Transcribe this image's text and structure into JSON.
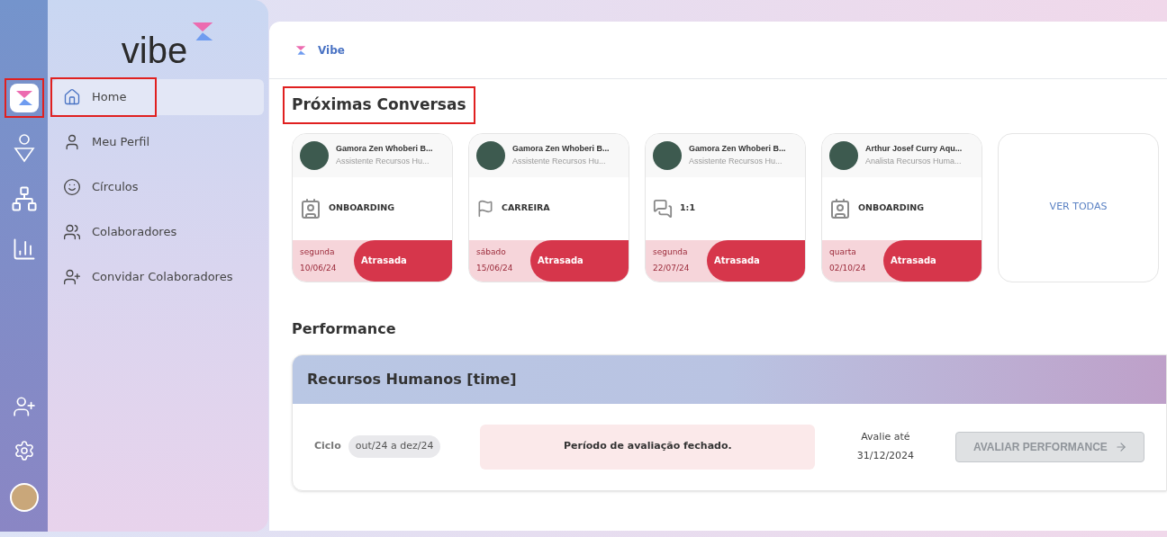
{
  "rail": {
    "items": [
      {
        "kind": "logo",
        "selected": true,
        "highlighted": true
      },
      {
        "kind": "ai",
        "selected": false,
        "highlighted": false
      },
      {
        "kind": "network",
        "selected": false,
        "highlighted": false
      },
      {
        "kind": "chart",
        "selected": false,
        "highlighted": false
      }
    ],
    "bottom": [
      {
        "kind": "add-user"
      },
      {
        "kind": "settings"
      },
      {
        "kind": "avatar"
      }
    ]
  },
  "sidebar": {
    "logo": "vibe",
    "items": [
      {
        "label": "Home",
        "kind": "home",
        "selected": true,
        "highlighted": true
      },
      {
        "label": "Meu Perfil",
        "kind": "user",
        "selected": false,
        "highlighted": false
      },
      {
        "label": "Círculos",
        "kind": "circles",
        "selected": false,
        "highlighted": false
      },
      {
        "label": "Colaboradores",
        "kind": "group",
        "selected": false,
        "highlighted": false
      },
      {
        "label": "Convidar Colaboradores",
        "kind": "add-user",
        "selected": false,
        "highlighted": false
      }
    ]
  },
  "breadcrumb": "Vibe",
  "conversations": {
    "title": "Próximas Conversas",
    "highlighted": true,
    "cards": [
      {
        "name": "Gamora Zen Whoberi B...",
        "role": "Assistente Recursos Hu...",
        "type": "ONBOARDING",
        "kind": "onboarding",
        "day": "segunda",
        "date": "10/06/24",
        "status": "Atrasada"
      },
      {
        "name": "Gamora Zen Whoberi B...",
        "role": "Assistente Recursos Hu...",
        "type": "CARREIRA",
        "kind": "flag",
        "day": "sábado",
        "date": "15/06/24",
        "status": "Atrasada"
      },
      {
        "name": "Gamora Zen Whoberi B...",
        "role": "Assistente Recursos Hu...",
        "type": "1:1",
        "kind": "chat",
        "day": "segunda",
        "date": "22/07/24",
        "status": "Atrasada"
      },
      {
        "name": "Arthur Josef Curry Aqu...",
        "role": "Analista Recursos Huma...",
        "type": "ONBOARDING",
        "kind": "onboarding",
        "day": "quarta",
        "date": "02/10/24",
        "status": "Atrasada"
      }
    ],
    "see_all": "VER TODAS"
  },
  "performance": {
    "title": "Performance",
    "team": "Recursos Humanos [time]",
    "cycle_label": "Ciclo",
    "cycle": "out/24 a dez/24",
    "notice": "Período de avaliação fechado.",
    "deadline_label": "Avalie até",
    "deadline": "31/12/2024",
    "button": {
      "label": "AVALIAR PERFORMANCE",
      "disabled": true
    }
  }
}
